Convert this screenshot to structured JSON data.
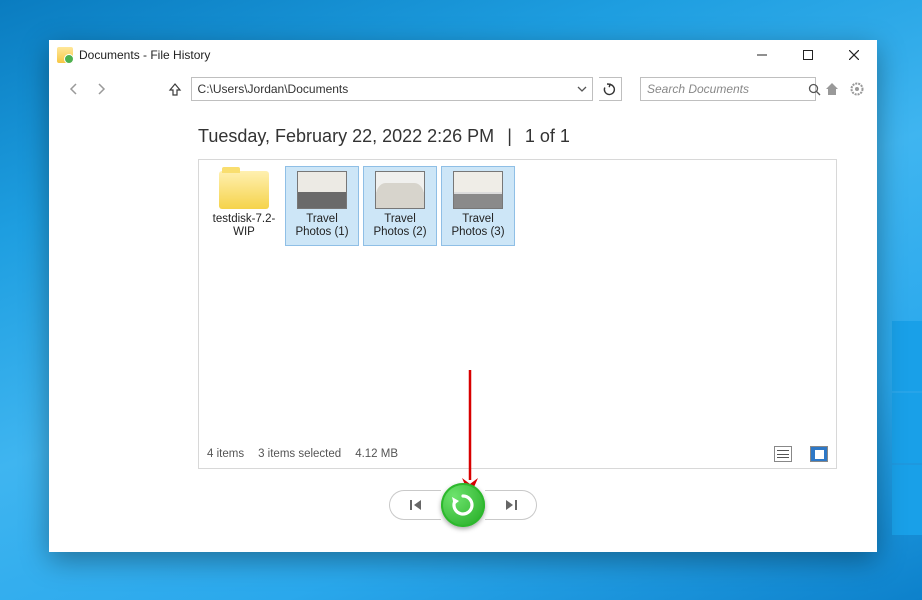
{
  "window": {
    "title": "Documents - File History"
  },
  "address": {
    "path": "C:\\Users\\Jordan\\Documents"
  },
  "search": {
    "placeholder": "Search Documents"
  },
  "header": {
    "datetime": "Tuesday, February 22, 2022 2:26 PM",
    "page_label": "1 of 1"
  },
  "items": [
    {
      "label": "testdisk-7.2-WIP",
      "kind": "folder",
      "selected": false
    },
    {
      "label": "Travel Photos (1)",
      "kind": "photo-a",
      "selected": true
    },
    {
      "label": "Travel Photos (2)",
      "kind": "photo-b",
      "selected": true
    },
    {
      "label": "Travel Photos (3)",
      "kind": "photo-c",
      "selected": true
    }
  ],
  "status": {
    "count_label": "4 items",
    "selection_label": "3 items selected",
    "size_label": "4.12 MB"
  }
}
